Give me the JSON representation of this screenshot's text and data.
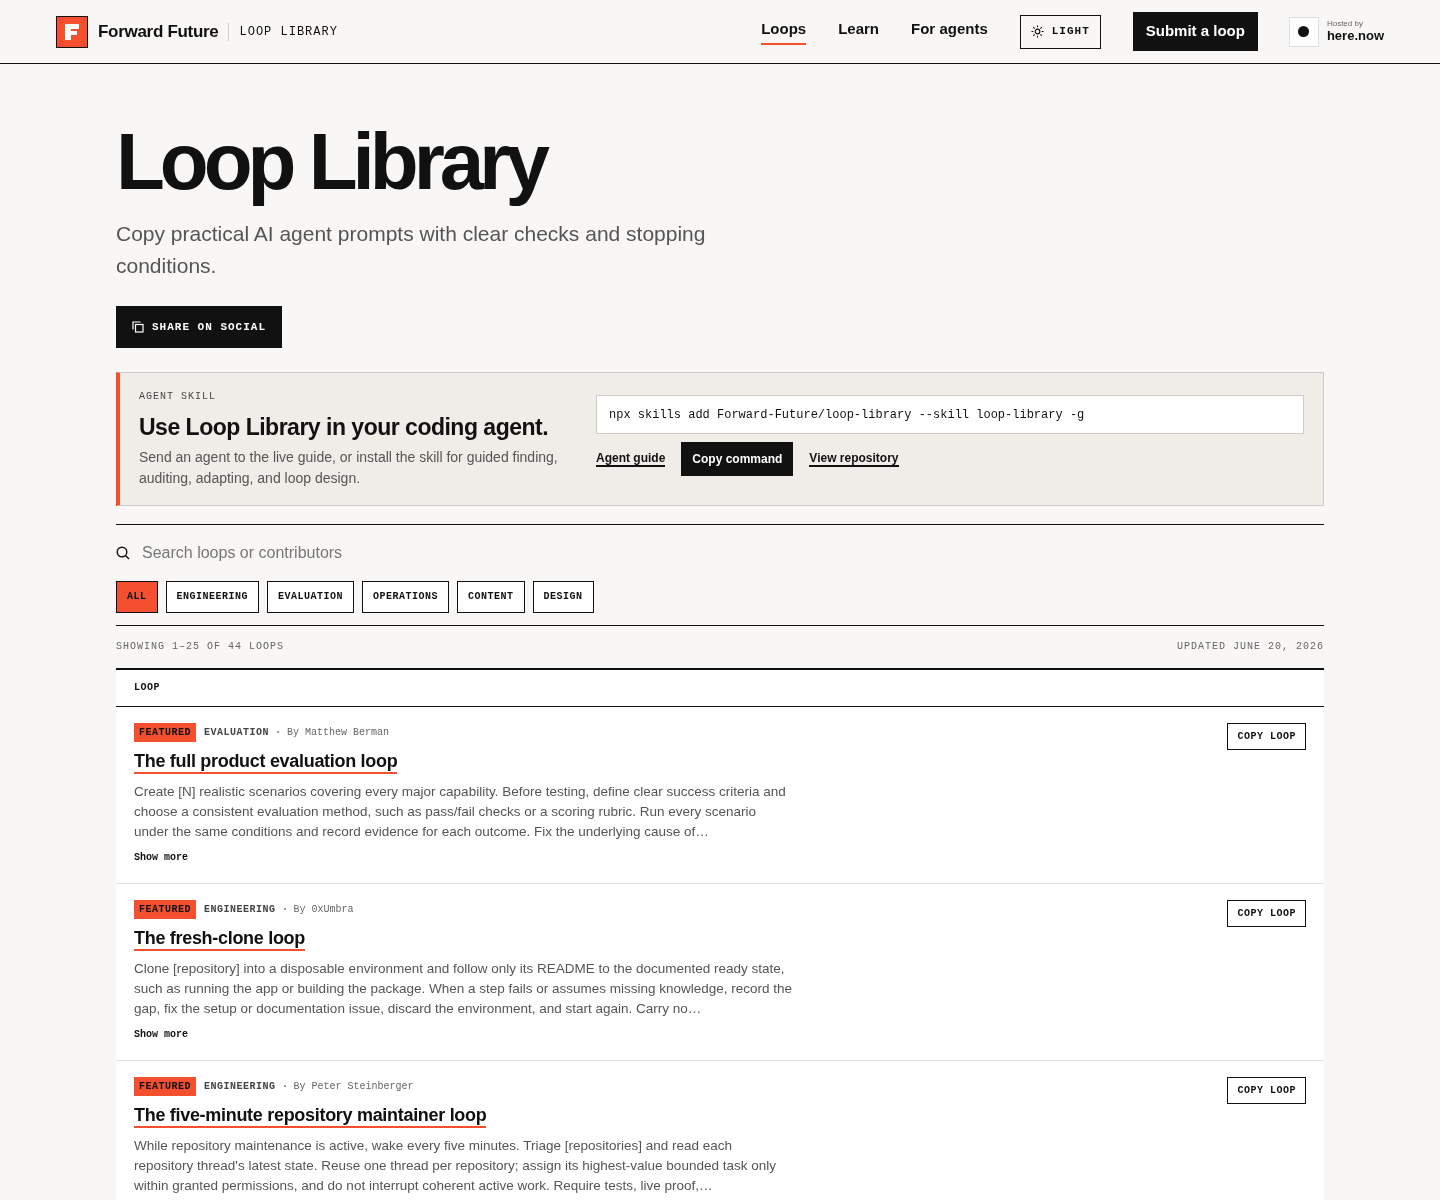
{
  "header": {
    "brand": "Forward Future",
    "product": "LOOP LIBRARY",
    "nav": [
      {
        "label": "Loops",
        "selected": true
      },
      {
        "label": "Learn",
        "selected": false
      },
      {
        "label": "For agents",
        "selected": false
      }
    ],
    "theme_button": "LIGHT",
    "submit_button": "Submit a loop",
    "host": {
      "caption": "Hosted by",
      "name": "here.now"
    }
  },
  "hero": {
    "title": "Loop Library",
    "subtitle": "Copy practical AI agent prompts with clear checks and stopping conditions.",
    "share_button": "SHARE ON SOCIAL"
  },
  "skill": {
    "eyebrow": "AGENT SKILL",
    "title": "Use Loop Library in your coding agent.",
    "text": "Send an agent to the live guide, or install the skill for guided finding, auditing, adapting, and loop design.",
    "command": "npx skills add Forward-Future/loop-library --skill loop-library -g",
    "links": [
      {
        "label": "Agent guide",
        "kind": "link"
      },
      {
        "label": "Copy command",
        "kind": "button"
      },
      {
        "label": "View repository",
        "kind": "link"
      }
    ]
  },
  "search": {
    "placeholder": "Search loops or contributors"
  },
  "filters": [
    {
      "label": "ALL",
      "selected": true
    },
    {
      "label": "ENGINEERING",
      "selected": false
    },
    {
      "label": "EVALUATION",
      "selected": false
    },
    {
      "label": "OPERATIONS",
      "selected": false
    },
    {
      "label": "CONTENT",
      "selected": false
    },
    {
      "label": "DESIGN",
      "selected": false
    }
  ],
  "summary": {
    "showing": "SHOWING 1–25 OF 44 LOOPS",
    "updated": "UPDATED JUNE 20, 2026"
  },
  "table": {
    "column": "LOOP",
    "rows": [
      {
        "featured": true,
        "badge": "FEATURED",
        "category": "EVALUATION",
        "author": "By Matthew Berman",
        "title": "The full product evaluation loop",
        "description": "Create [N] realistic scenarios covering every major capability. Before testing, define clear success criteria and choose a consistent evaluation method, such as pass/fail checks or a scoring rubric. Run every scenario under the same conditions and record evidence for each outcome. Fix the underlying cause of…",
        "more": "Show more",
        "copy": "COPY LOOP"
      },
      {
        "featured": true,
        "badge": "FEATURED",
        "category": "ENGINEERING",
        "author": "By 0xUmbra",
        "title": "The fresh-clone loop",
        "description": "Clone [repository] into a disposable environment and follow only its README to the documented ready state, such as running the app or building the package. When a step fails or assumes missing knowledge, record the gap, fix the setup or documentation issue, discard the environment, and start again. Carry no…",
        "more": "Show more",
        "copy": "COPY LOOP"
      },
      {
        "featured": true,
        "badge": "FEATURED",
        "category": "ENGINEERING",
        "author": "By Peter Steinberger",
        "title": "The five-minute repository maintainer loop",
        "description": "While repository maintenance is active, wake every five minutes. Triage [repositories] and read each repository thread's latest state. Reuse one thread per repository; assign its highest-value bounded task only within granted permissions, and do not interrupt coherent active work. Require tests, live proof,…",
        "copy": "COPY LOOP"
      }
    ]
  }
}
